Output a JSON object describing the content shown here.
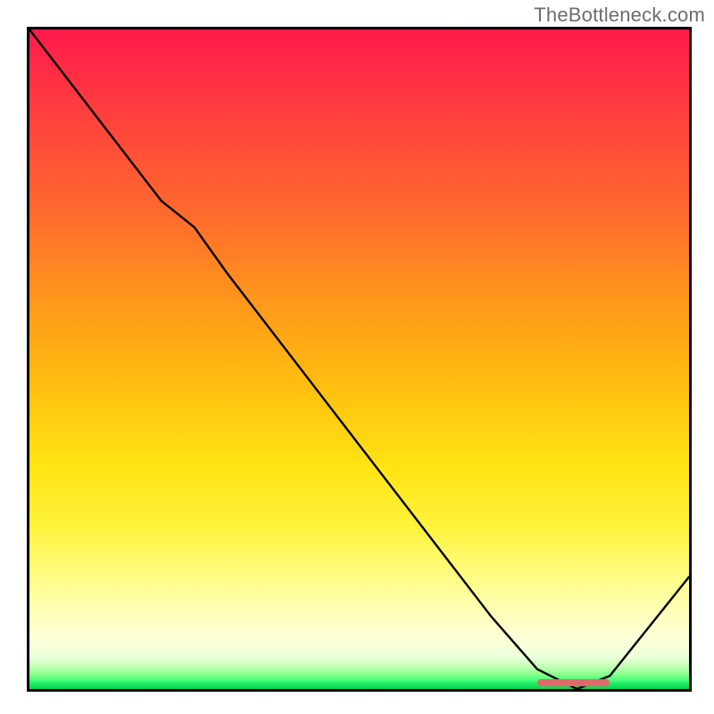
{
  "attribution": "TheBottleneck.com",
  "colors": {
    "gradient_top": "#ff1a4b",
    "gradient_mid": "#ffe312",
    "gradient_bottom": "#0ed34e",
    "curve_stroke": "#000000",
    "marker": "#e06a6a",
    "frame": "#000000"
  },
  "chart_data": {
    "type": "line",
    "title": "",
    "xlabel": "",
    "ylabel": "",
    "xlim": [
      0,
      100
    ],
    "ylim": [
      0,
      100
    ],
    "x": [
      0,
      10,
      20,
      25,
      30,
      40,
      50,
      60,
      70,
      77,
      83,
      88,
      100
    ],
    "values": [
      100,
      87,
      74,
      70,
      63,
      50,
      37,
      24,
      11,
      3,
      0,
      2,
      17
    ],
    "marker_range_x": [
      77,
      88
    ],
    "marker_y": 1,
    "notes": "y is percent-of-plot-height from the bottom (0 = green baseline, 100 = red top). The black curve follows these points; the pink marker spans marker_range_x at the bottom."
  }
}
